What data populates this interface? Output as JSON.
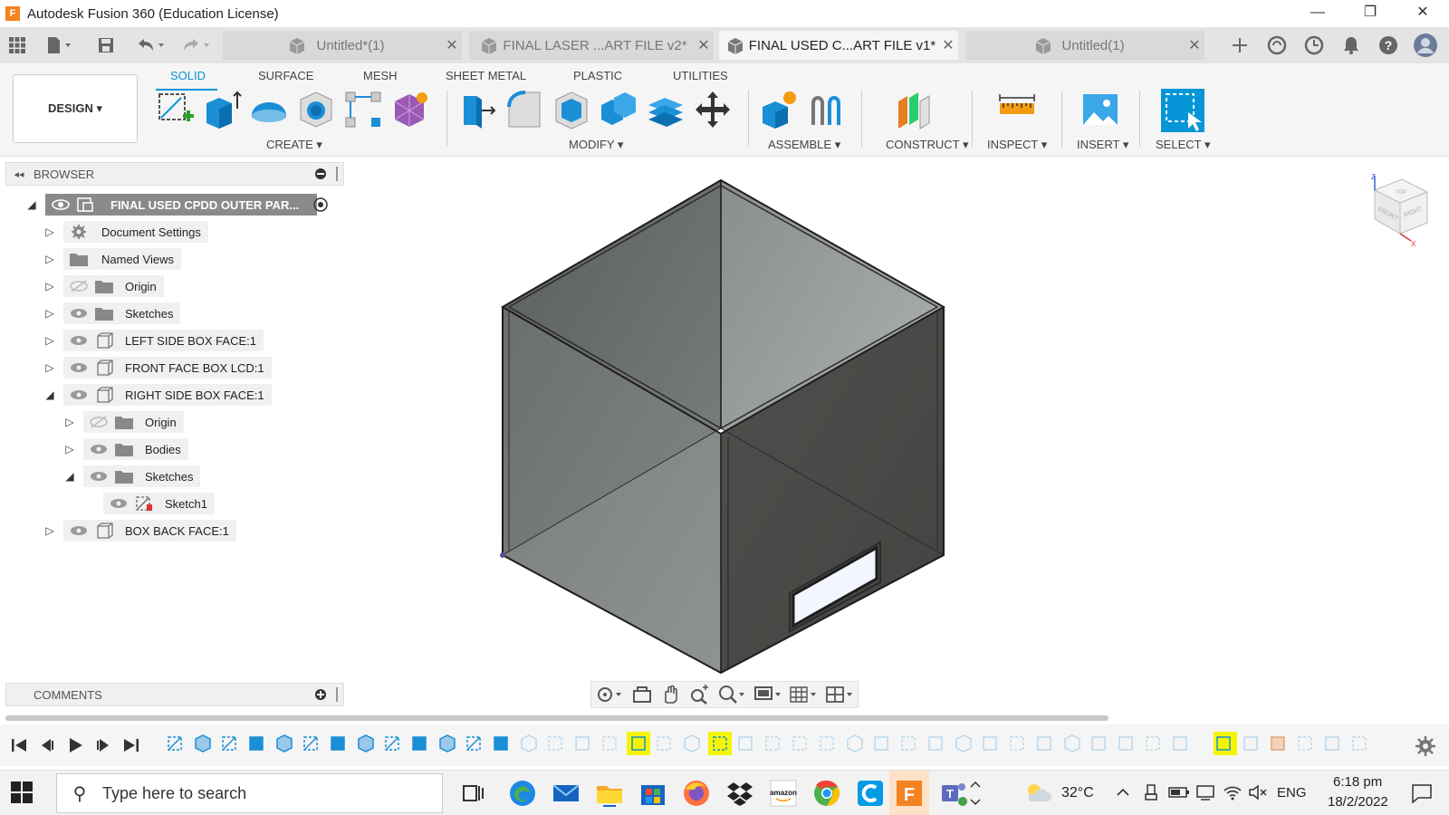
{
  "window": {
    "title": "Autodesk Fusion 360 (Education License)",
    "app_icon_letter": "F",
    "minimize": "—",
    "maximize": "❐",
    "close": "✕"
  },
  "doc_tabs": [
    {
      "label": "Untitled*(1)",
      "active": false
    },
    {
      "label": "FINAL LASER ...ART FILE v2*",
      "active": false
    },
    {
      "label": "FINAL USED C...ART FILE v1*",
      "active": true
    },
    {
      "label": "Untitled(1)",
      "active": false
    }
  ],
  "ribbon": {
    "workspace": "DESIGN ▾",
    "tabs": [
      "SOLID",
      "SURFACE",
      "MESH",
      "SHEET METAL",
      "PLASTIC",
      "UTILITIES"
    ],
    "active_tab": "SOLID",
    "groups": {
      "create": "CREATE ▾",
      "modify": "MODIFY ▾",
      "assemble": "ASSEMBLE ▾",
      "construct": "CONSTRUCT ▾",
      "inspect": "INSPECT ▾",
      "insert": "INSERT ▾",
      "select": "SELECT ▾"
    }
  },
  "browser": {
    "title": "BROWSER",
    "collapse_glyph": "◂◂",
    "root": "FINAL USED CPDD OUTER PAR...",
    "items": [
      {
        "label": "Document Settings"
      },
      {
        "label": "Named Views"
      },
      {
        "label": "Origin"
      },
      {
        "label": "Sketches"
      },
      {
        "label": "LEFT SIDE BOX FACE:1"
      },
      {
        "label": "FRONT FACE  BOX LCD:1"
      },
      {
        "label": "RIGHT SIDE BOX FACE:1"
      },
      {
        "label": "Origin"
      },
      {
        "label": "Bodies"
      },
      {
        "label": "Sketches"
      },
      {
        "label": "Sketch1"
      },
      {
        "label": "BOX BACK FACE:1"
      }
    ]
  },
  "comments": {
    "title": "COMMENTS"
  },
  "viewcube": {
    "top": "TOP",
    "front": "FRONT",
    "right": "RIGHT"
  },
  "taskbar": {
    "search_placeholder": "Type here to search",
    "temperature": "32°C",
    "language": "ENG",
    "time": "6:18 pm",
    "date": "18/2/2022"
  },
  "colors": {
    "accent": "#0696d7",
    "fusion_orange": "#f58220",
    "box_face_dark": "#4b4d4a",
    "box_face_light": "#737773"
  }
}
